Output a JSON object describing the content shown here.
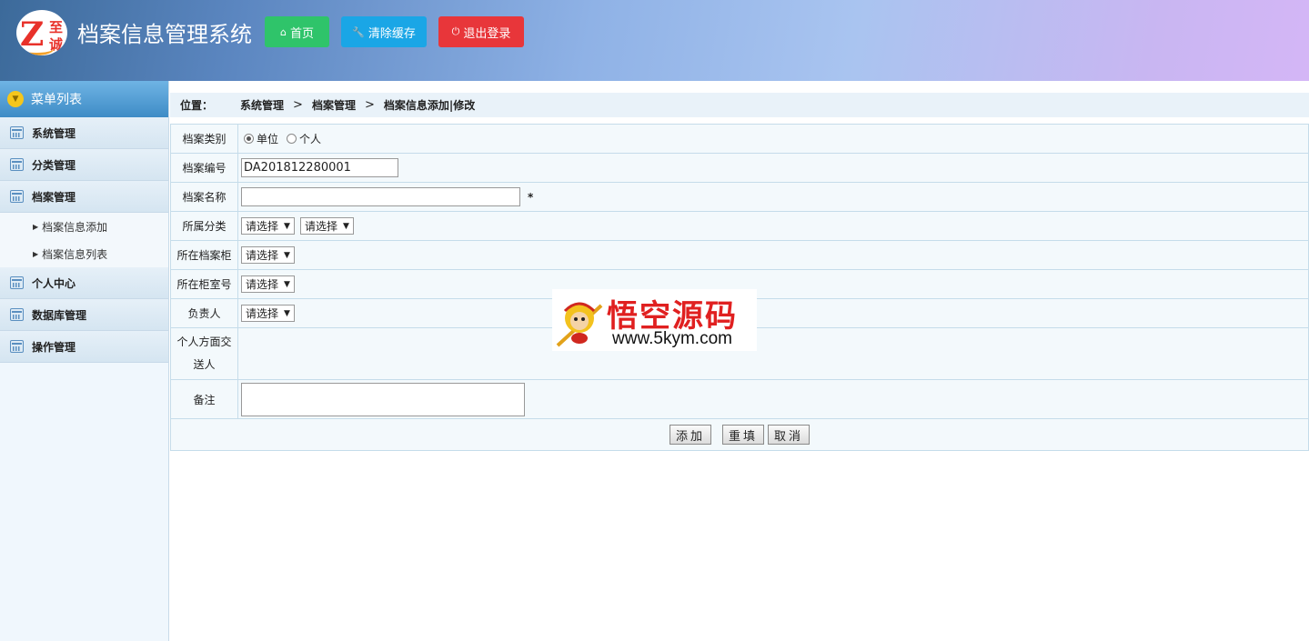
{
  "header": {
    "title": "档案信息管理系统",
    "logo_chars": [
      "Z",
      "至",
      "诚"
    ],
    "buttons": {
      "home": "首页",
      "clear_cache": "清除缓存",
      "logout": "退出登录"
    },
    "colors": {
      "home": "#2fc46a",
      "clear_cache": "#1aa6e6",
      "logout": "#e8363a"
    }
  },
  "sidebar": {
    "head": "菜单列表",
    "items": [
      {
        "label": "系统管理"
      },
      {
        "label": "分类管理"
      },
      {
        "label": "档案管理"
      },
      {
        "label": "个人中心"
      },
      {
        "label": "数据库管理"
      },
      {
        "label": "操作管理"
      }
    ],
    "sub_items": [
      "档案信息添加",
      "档案信息列表"
    ]
  },
  "breadcrumb": {
    "label": "位置：",
    "parts": [
      "系统管理",
      "档案管理",
      "档案信息添加|修改"
    ]
  },
  "form": {
    "type": {
      "label": "档案类别",
      "options": [
        "单位",
        "个人"
      ],
      "selected": "单位"
    },
    "number": {
      "label": "档案编号",
      "value": "DA201812280001"
    },
    "name": {
      "label": "档案名称",
      "value": "",
      "required_mark": "*"
    },
    "category": {
      "label": "所属分类",
      "select1": "请选择",
      "select2": "请选择"
    },
    "cabinet": {
      "label": "所在档案柜",
      "select": "请选择"
    },
    "room": {
      "label": "所在柜室号",
      "select": "请选择"
    },
    "owner": {
      "label": "负责人",
      "select": "请选择"
    },
    "sender": {
      "label": "个人方面交送人"
    },
    "remark": {
      "label": "备注",
      "value": ""
    },
    "buttons": {
      "add": "添加",
      "reset": "重填",
      "cancel": "取消"
    }
  },
  "watermark": {
    "title": "悟空源码",
    "url": "www.5kym.com"
  }
}
